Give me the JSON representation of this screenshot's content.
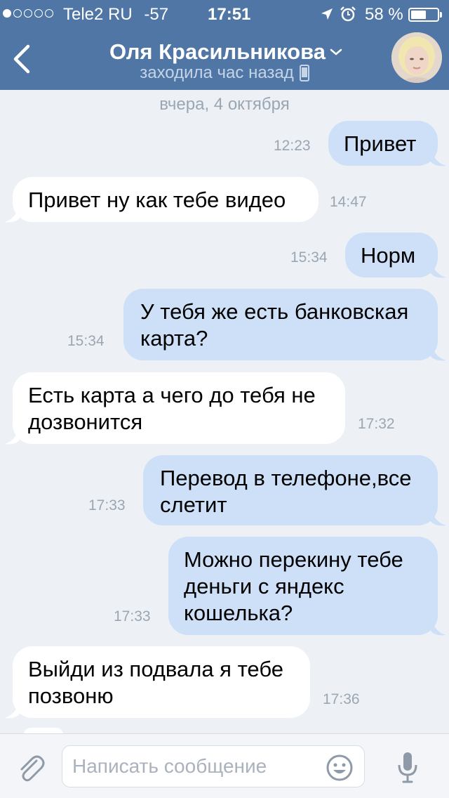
{
  "status_bar": {
    "carrier": "Tele2 RU",
    "signal_dbm": "-57",
    "time": "17:51",
    "battery_percent": "58 %",
    "battery_level": 0.58
  },
  "header": {
    "contact_name": "Оля Красильникова",
    "last_seen": "заходила час назад"
  },
  "chat": {
    "date_separator": "вчера, 4 октября",
    "messages": [
      {
        "direction": "out",
        "text": "Привет",
        "time": "12:23"
      },
      {
        "direction": "in",
        "text": "Привет ну как тебе видео",
        "time": "14:47"
      },
      {
        "direction": "out",
        "text": "Норм",
        "time": "15:34"
      },
      {
        "direction": "out",
        "lines": [
          "У тебя же есть банковская",
          "карта?"
        ],
        "time": "15:34"
      },
      {
        "direction": "in",
        "lines": [
          "Есть карта а чего до тебя не",
          "дозвонится"
        ],
        "time": "17:32"
      },
      {
        "direction": "out",
        "lines": [
          "Перевод в телефоне,все",
          "слетит"
        ],
        "time": "17:33"
      },
      {
        "direction": "out",
        "lines": [
          "Можно перекину тебе",
          "деньги с яндекс",
          "кошелька?"
        ],
        "time": "17:33"
      },
      {
        "direction": "in",
        "lines": [
          "Выйди из подвала я тебе",
          "позвоню"
        ],
        "time": "17:36"
      }
    ]
  },
  "input_bar": {
    "placeholder": "Написать сообщение"
  },
  "colors": {
    "header_bg": "#4f76a5",
    "chat_bg": "#edf1f5",
    "outgoing_bubble": "#cde0f8",
    "incoming_bubble": "#ffffff",
    "time_text": "#9aa6b3"
  },
  "icons": [
    "back-chevron-icon",
    "dropdown-chevron-icon",
    "phone-icon",
    "location-arrow-icon",
    "alarm-clock-icon",
    "battery-icon",
    "paperclip-icon",
    "emoji-icon",
    "microphone-icon"
  ]
}
